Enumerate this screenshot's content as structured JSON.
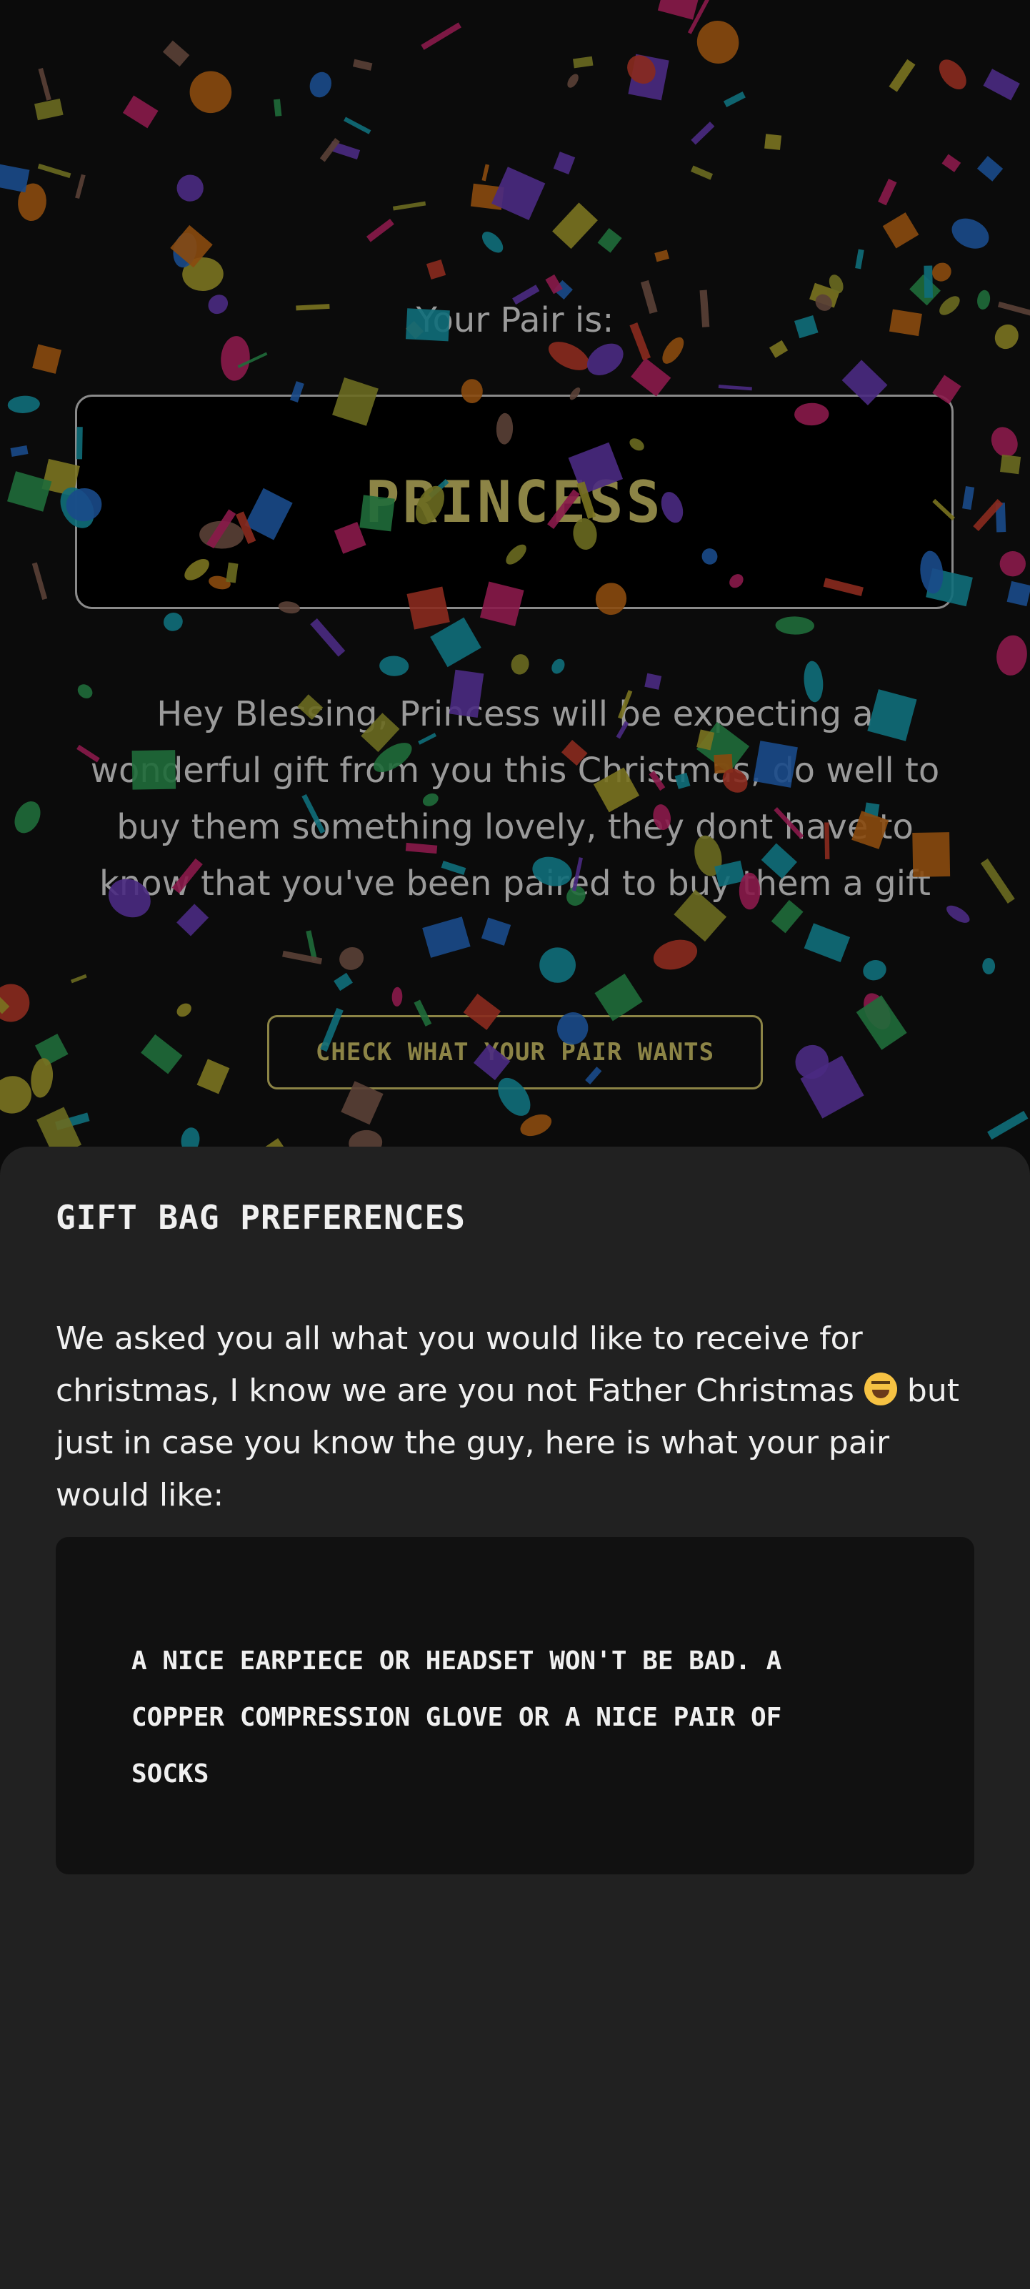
{
  "pair": {
    "label": "Your Pair is:",
    "name": "PRINCESS",
    "message": "Hey Blessing, Princess will be expecting a wonderful gift from you this Christmas, do well to buy them something lovely, they dont have to know that you've been paired to buy them a gift",
    "check_button_label": "CHECK WHAT YOUR PAIR WANTS"
  },
  "gift_bag": {
    "title": "GIFT BAG PREFERENCES",
    "intro_before_emoji": "We asked you all what you would like to receive for christmas, I know we are you not Father Christmas ",
    "intro_emoji_icon": "grinning-squinting-face",
    "intro_after_emoji": " but just in case you know the guy, here is what your pair would like:",
    "preference": "A NICE EARPIECE OR HEADSET WON'T BE BAD. A COPPER COMPRESSION GLOVE OR A NICE PAIR OF SOCKS"
  },
  "colors": {
    "background": "#0b0b0b",
    "panel": "#212121",
    "wish_box": "#111111",
    "accent_gold": "#8c8446",
    "muted_text": "#9a9a9a"
  }
}
